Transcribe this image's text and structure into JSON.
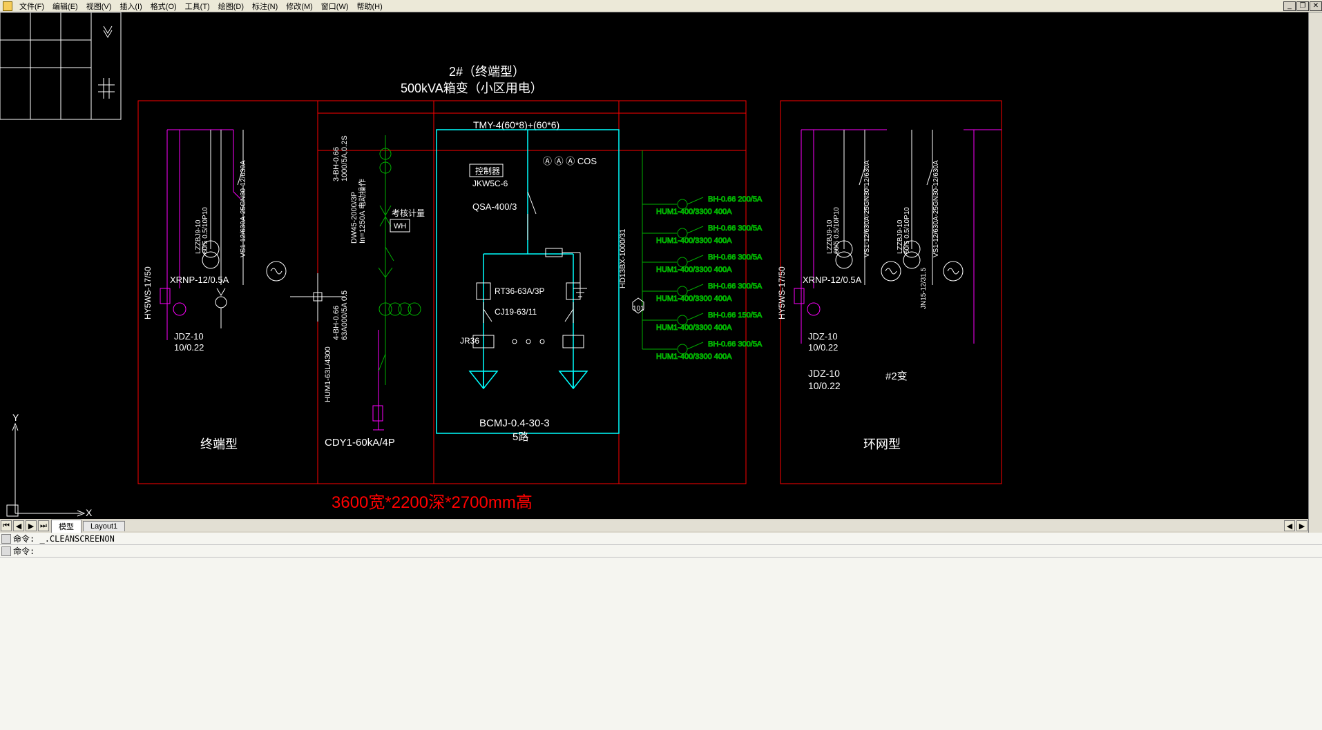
{
  "menu": {
    "items": [
      "文件(F)",
      "编辑(E)",
      "视图(V)",
      "插入(I)",
      "格式(O)",
      "工具(T)",
      "绘图(D)",
      "标注(N)",
      "修改(M)",
      "窗口(W)",
      "帮助(H)"
    ]
  },
  "window_controls": {
    "min": "_",
    "restore": "❐",
    "close": "✕"
  },
  "tabs": {
    "model": "模型",
    "layout1": "Layout1"
  },
  "command": {
    "prompt": "命令:",
    "history": "_.CLEANSCREENON"
  },
  "drawing": {
    "title_line1": "2#（终端型）",
    "title_line2": "500kVA箱变（小区用电）",
    "busbar": "TMY-4(60*8)+(60*6)",
    "left_cabinet_label": "终端型",
    "right_cabinet_label": "环网型",
    "dimension_note": "3600宽*2200深*2700mm高",
    "spd_label": "CDY1-60kA/4P",
    "lv": {
      "hy_label": "HY5WS-17/50",
      "xrnp_label": "XRNP-12/0.5A",
      "jdz_label_a": "JDZ-10",
      "jdz_label_b": "10/0.22",
      "lzz_a": "LZZBJ9-10",
      "lzz_b": "60/5 0.5/10P10",
      "vs1": "VS1-12/630A-25GN30-12/630A"
    },
    "acb": {
      "ct_a": "3-BH-0.66",
      "ct_b": "1000/5A,0.2S",
      "dw45_a": "DW45-2000/3P",
      "dw45_b": "In=1250A 电动操作",
      "meter": "考核计量",
      "wh": "WH",
      "ct2_a": "4-BH-0.66",
      "ct2_b": "63A000/5A 0.5",
      "mccb": "HUM1-63L/4300"
    },
    "cap": {
      "controller_a": "控制器",
      "controller_b": "JKW5C-6",
      "qsa": "QSA-400/3",
      "fuse": "RT36-63A/3P",
      "contactor": "CJ19-63/11",
      "relay": "JR36",
      "bank_a": "BCMJ-0.4-30-3",
      "bank_b": "5路",
      "meters": "Ⓐ Ⓐ Ⓐ COS"
    },
    "feeders": {
      "switch": "HD13BX-1000/31",
      "marker": "101",
      "rows": [
        {
          "ct": "BH-0.66 200/5A",
          "mccb": "HUM1-400/3300 400A"
        },
        {
          "ct": "BH-0.66 300/5A",
          "mccb": "HUM1-400/3300 400A"
        },
        {
          "ct": "BH-0.66 300/5A",
          "mccb": "HUM1-400/3300 400A"
        },
        {
          "ct": "BH-0.66 300/5A",
          "mccb": "HUM1-400/3300 400A"
        },
        {
          "ct": "BH-0.66 150/5A",
          "mccb": "HUM1-400/3300 400A"
        },
        {
          "ct": "BH-0.66 300/5A",
          "mccb": "HUM1-400/3300 400A"
        }
      ]
    },
    "rv": {
      "hy_label": "HY5WS-17/50",
      "xrnp_label": "XRNP-12/0.5A",
      "jdz_a": "JDZ-10",
      "jdz_b": "10/0.22",
      "jdz2_a": "JDZ-10",
      "jdz2_b": "10/0.22",
      "tx2": "#2变",
      "lzz_a": "LZZBJ9-10",
      "lzz_b": "60/5 0.5/10P10",
      "vs1": "VS1-12/630A-25GN30-12/630A",
      "jn_a": "LZZBJ9-10",
      "jn_b": "60/5 0.5/10P10",
      "jn15_a": "JN15-12/31.5",
      "vs1b": "VS1-12/630A-25GN30-12/630A"
    },
    "ucs": {
      "x": "X",
      "y": "Y"
    }
  }
}
